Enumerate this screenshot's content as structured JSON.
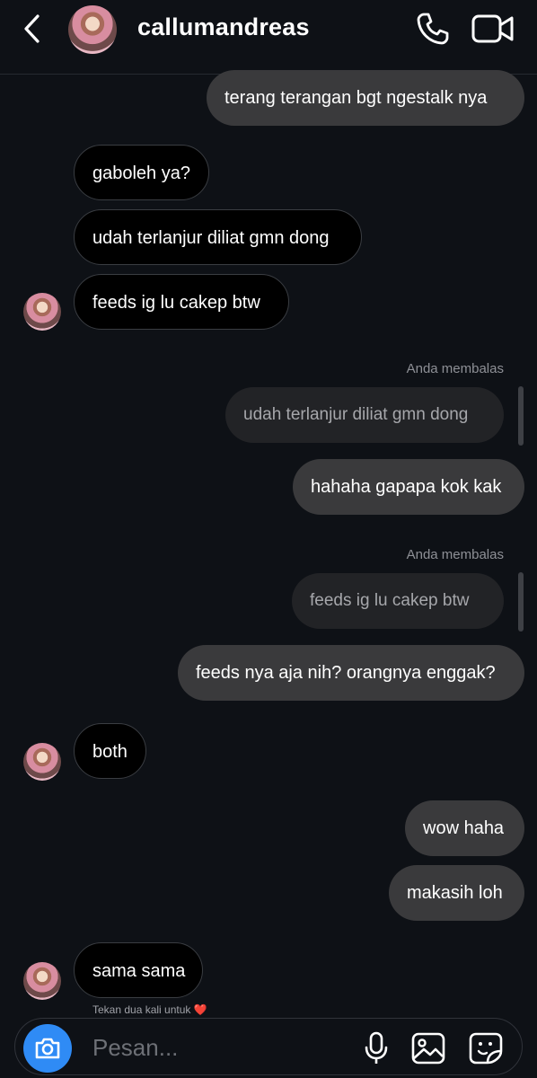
{
  "header": {
    "username": "callumandreas",
    "icons": {
      "back": "chevron-left-icon",
      "call": "phone-icon",
      "video": "video-camera-icon"
    }
  },
  "messages": [
    {
      "id": "m1",
      "from": "me",
      "text": "terang terangan bgt ngestalk nya"
    },
    {
      "id": "m2",
      "from": "them",
      "text": "gaboleh ya?"
    },
    {
      "id": "m3",
      "from": "them",
      "text": "udah terlanjur diliat gmn dong"
    },
    {
      "id": "m4",
      "from": "them",
      "text": "feeds ig lu cakep btw"
    },
    {
      "id": "m5",
      "from": "me",
      "reply_label": "Anda membalas",
      "quoted": "udah terlanjur diliat gmn dong",
      "text": "hahaha gapapa kok kak"
    },
    {
      "id": "m6",
      "from": "me",
      "reply_label": "Anda membalas",
      "quoted": "feeds ig lu cakep btw",
      "text": "feeds nya aja nih? orangnya enggak?"
    },
    {
      "id": "m7",
      "from": "them",
      "text": "both"
    },
    {
      "id": "m8",
      "from": "me",
      "text": "wow haha"
    },
    {
      "id": "m9",
      "from": "me",
      "text": "makasih loh"
    },
    {
      "id": "m10",
      "from": "them",
      "text": "sama sama"
    }
  ],
  "double_tap_hint": "Tekan dua kali untuk",
  "double_tap_emoji": "❤️",
  "composer": {
    "placeholder": "Pesan...",
    "icons": {
      "camera": "camera-icon",
      "mic": "microphone-icon",
      "gallery": "image-gallery-icon",
      "sticker": "sticker-icon"
    }
  },
  "colors": {
    "background": "#0e1116",
    "sent_bubble": "#3a3a3c",
    "received_bubble": "#000000",
    "camera_button": "#2f8bf5",
    "heart": "#e8322f"
  }
}
